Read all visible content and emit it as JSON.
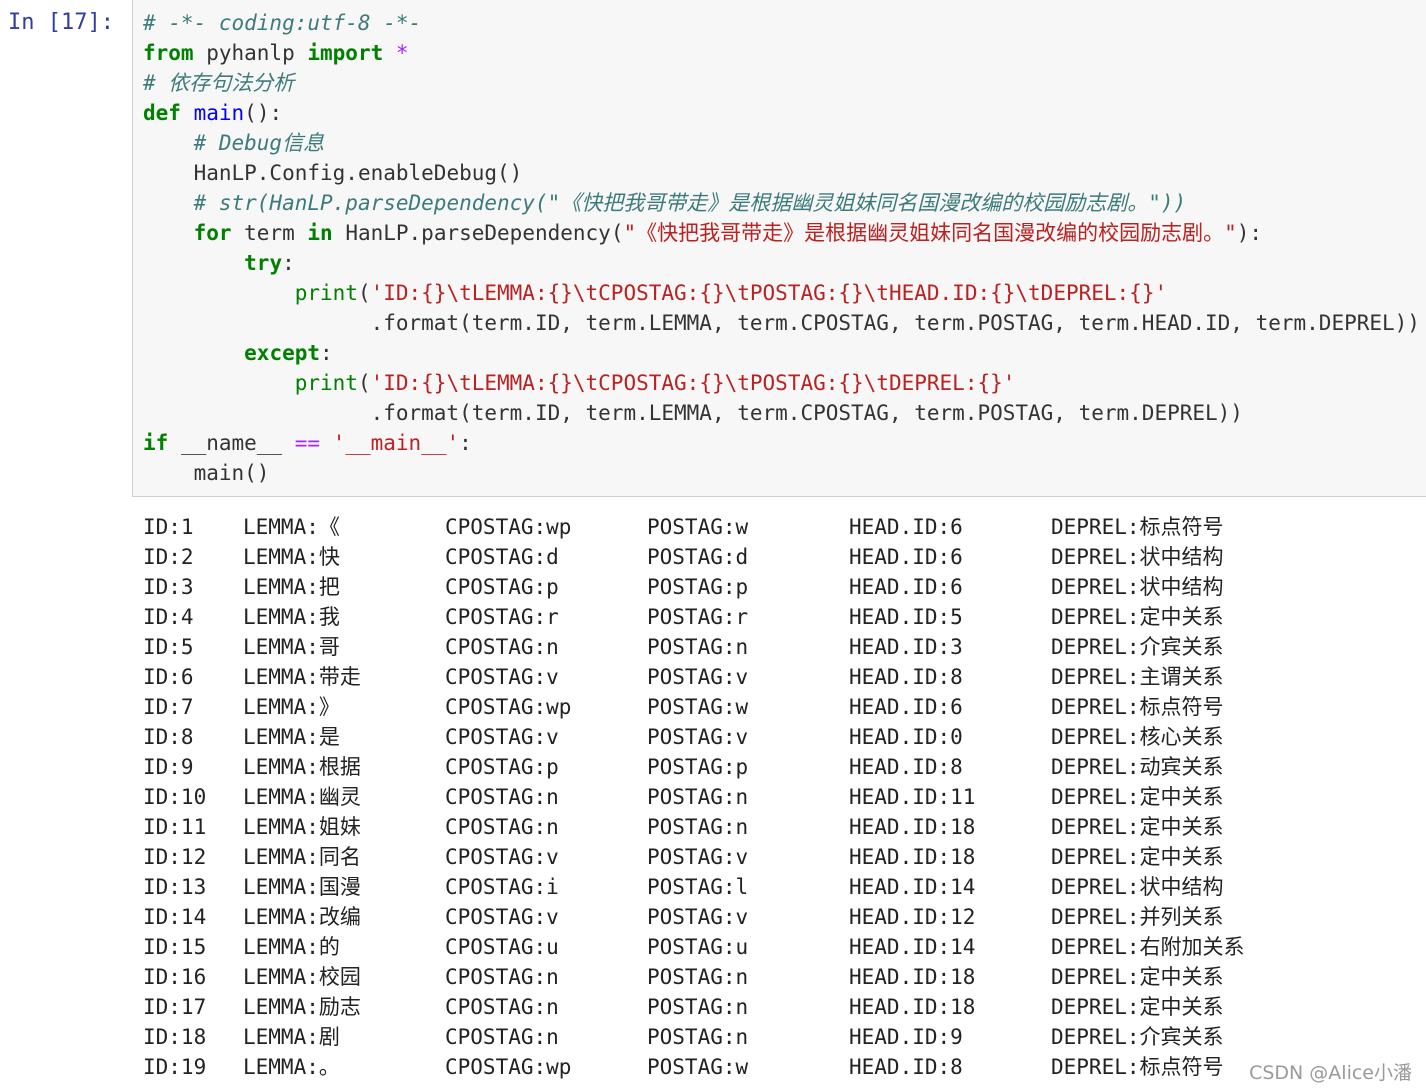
{
  "cell": {
    "prompt": "In  [17]:",
    "code": {
      "l1": "# -*- coding:utf-8 -*-",
      "l2_from": "from",
      "l2_mod": " pyhanlp ",
      "l2_import": "import",
      "l2_star": " *",
      "l3": "# 依存句法分析",
      "l4_def": "def",
      "l4_name": "main",
      "l4_rest": "():",
      "l5": "# Debug信息",
      "l6": "HanLP.Config.enableDebug()",
      "l7": "# str(HanLP.parseDependency(\"《快把我哥带走》是根据幽灵姐妹同名国漫改编的校园励志剧。\"))",
      "l8_for": "for",
      "l8_term": " term ",
      "l8_in": "in",
      "l8_call": " HanLP.parseDependency(",
      "l8_str": "\"《快把我哥带走》是根据幽灵姐妹同名国漫改编的校园励志剧。\"",
      "l8_end": "):",
      "l9": "try",
      "l10_print": "print",
      "l10_str": "'ID:{}\\tLEMMA:{}\\tCPOSTAG:{}\\tPOSTAG:{}\\tHEAD.ID:{}\\tDEPREL:{}'",
      "l11": ".format(term.ID, term.LEMMA, term.CPOSTAG, term.POSTAG, term.HEAD.ID, term.DEPREL))",
      "l12": "except",
      "l13_print": "print",
      "l13_str": "'ID:{}\\tLEMMA:{}\\tCPOSTAG:{}\\tPOSTAG:{}\\tDEPREL:{}'",
      "l14": ".format(term.ID, term.LEMMA, term.CPOSTAG, term.POSTAG, term.DEPREL))",
      "l15_if": "if",
      "l15_name": " __name__ ",
      "l15_eq": "==",
      "l15_str": "'__main__'",
      "l16": "main()"
    }
  },
  "output_rows": [
    [
      "ID:1",
      "LEMMA:《",
      "CPOSTAG:wp",
      "POSTAG:w",
      "HEAD.ID:6",
      "DEPREL:标点符号"
    ],
    [
      "ID:2",
      "LEMMA:快",
      "CPOSTAG:d",
      "POSTAG:d",
      "HEAD.ID:6",
      "DEPREL:状中结构"
    ],
    [
      "ID:3",
      "LEMMA:把",
      "CPOSTAG:p",
      "POSTAG:p",
      "HEAD.ID:6",
      "DEPREL:状中结构"
    ],
    [
      "ID:4",
      "LEMMA:我",
      "CPOSTAG:r",
      "POSTAG:r",
      "HEAD.ID:5",
      "DEPREL:定中关系"
    ],
    [
      "ID:5",
      "LEMMA:哥",
      "CPOSTAG:n",
      "POSTAG:n",
      "HEAD.ID:3",
      "DEPREL:介宾关系"
    ],
    [
      "ID:6",
      "LEMMA:带走",
      "CPOSTAG:v",
      "POSTAG:v",
      "HEAD.ID:8",
      "DEPREL:主谓关系"
    ],
    [
      "ID:7",
      "LEMMA:》",
      "CPOSTAG:wp",
      "POSTAG:w",
      "HEAD.ID:6",
      "DEPREL:标点符号"
    ],
    [
      "ID:8",
      "LEMMA:是",
      "CPOSTAG:v",
      "POSTAG:v",
      "HEAD.ID:0",
      "DEPREL:核心关系"
    ],
    [
      "ID:9",
      "LEMMA:根据",
      "CPOSTAG:p",
      "POSTAG:p",
      "HEAD.ID:8",
      "DEPREL:动宾关系"
    ],
    [
      "ID:10",
      "LEMMA:幽灵",
      "CPOSTAG:n",
      "POSTAG:n",
      "HEAD.ID:11",
      "DEPREL:定中关系"
    ],
    [
      "ID:11",
      "LEMMA:姐妹",
      "CPOSTAG:n",
      "POSTAG:n",
      "HEAD.ID:18",
      "DEPREL:定中关系"
    ],
    [
      "ID:12",
      "LEMMA:同名",
      "CPOSTAG:v",
      "POSTAG:v",
      "HEAD.ID:18",
      "DEPREL:定中关系"
    ],
    [
      "ID:13",
      "LEMMA:国漫",
      "CPOSTAG:i",
      "POSTAG:l",
      "HEAD.ID:14",
      "DEPREL:状中结构"
    ],
    [
      "ID:14",
      "LEMMA:改编",
      "CPOSTAG:v",
      "POSTAG:v",
      "HEAD.ID:12",
      "DEPREL:并列关系"
    ],
    [
      "ID:15",
      "LEMMA:的",
      "CPOSTAG:u",
      "POSTAG:u",
      "HEAD.ID:14",
      "DEPREL:右附加关系"
    ],
    [
      "ID:16",
      "LEMMA:校园",
      "CPOSTAG:n",
      "POSTAG:n",
      "HEAD.ID:18",
      "DEPREL:定中关系"
    ],
    [
      "ID:17",
      "LEMMA:励志",
      "CPOSTAG:n",
      "POSTAG:n",
      "HEAD.ID:18",
      "DEPREL:定中关系"
    ],
    [
      "ID:18",
      "LEMMA:剧",
      "CPOSTAG:n",
      "POSTAG:n",
      "HEAD.ID:9",
      "DEPREL:介宾关系"
    ],
    [
      "ID:19",
      "LEMMA:。",
      "CPOSTAG:wp",
      "POSTAG:w",
      "HEAD.ID:8",
      "DEPREL:标点符号"
    ]
  ],
  "watermark": "CSDN @Alice小潘"
}
